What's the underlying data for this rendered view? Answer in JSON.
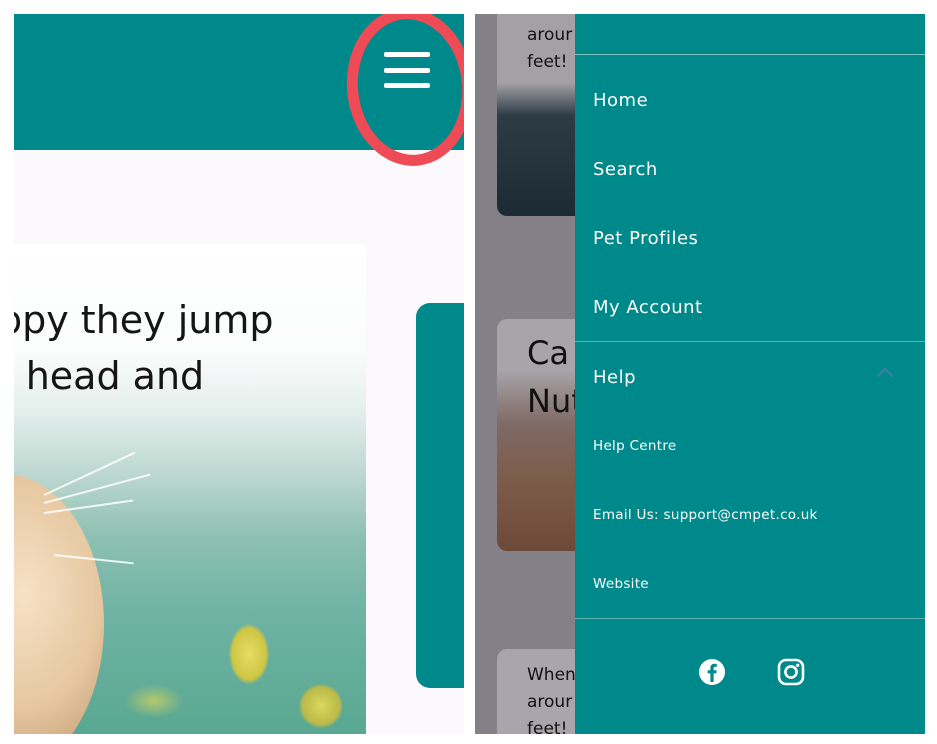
{
  "left": {
    "hero_text": "ppy they jump\nr head and",
    "menu_button_icon": "hamburger-menu-icon",
    "annotation_color": "#ee4b56"
  },
  "right": {
    "bg_card1_text": "arour\nfeet!",
    "bg_card2_title": "Ca\nNut",
    "bg_card3_text": "When\narour\nfeet!",
    "menu": {
      "items": [
        "Home",
        "Search",
        "Pet Profiles",
        "My Account"
      ],
      "help_label": "Help",
      "help_expanded": true,
      "help_sub_items": [
        "Help Centre",
        "Email Us: support@cmpet.co.uk",
        "Website"
      ],
      "social_icons": [
        "facebook-icon",
        "instagram-icon"
      ]
    }
  },
  "colors": {
    "brand_teal": "#00898a",
    "overlay_gray": "#848088",
    "text_white": "#ffffff"
  }
}
